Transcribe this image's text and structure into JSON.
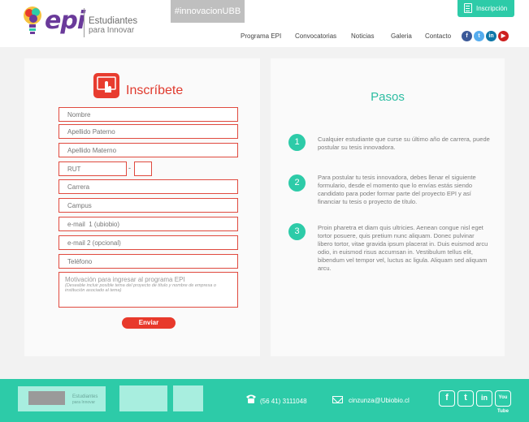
{
  "header": {
    "logo_text": "epi",
    "tagline_line1": "Estudiantes",
    "tagline_line2": "para Innovar",
    "hashtag": "#innovacionUBB",
    "inscripcion_button": "Inscripción",
    "nav": [
      "Programa EPI",
      "Convocatorias",
      "Noticias",
      "Galeria",
      "Contacto"
    ],
    "social": [
      {
        "icon": "facebook-icon",
        "glyph": "f",
        "color": "#3b5998"
      },
      {
        "icon": "twitter-icon",
        "glyph": "t",
        "color": "#55acee"
      },
      {
        "icon": "linkedin-icon",
        "glyph": "in",
        "color": "#0e76a8"
      },
      {
        "icon": "youtube-icon",
        "glyph": "▶",
        "color": "#cd201f"
      }
    ]
  },
  "form": {
    "title": "Inscríbete",
    "fields": {
      "nombre": "Nombre",
      "apellido_paterno": "Apellido Paterno",
      "apellido_materno": "Apellido Materno",
      "rut": "RUT",
      "rut_separator": "-",
      "carrera": "Carrera",
      "campus": "Campus",
      "email1": "e-mail  1 (ubiobio)",
      "email2": "e-mail 2 (opcional)",
      "telefono": "Teléfono",
      "motivacion": "Motivación para ingresar al programa EPI",
      "motivacion_hint": "(Deseable incluir posible tema del proyecto de título y nombre de empresa o institución asociado al tema)"
    },
    "submit": "Enviar",
    "accent_color": "#e8392b"
  },
  "steps": {
    "title": "Pasos",
    "items": [
      {
        "num": "1",
        "text": "Cualquier estudiante que curse su último año de carrera, puede postular su tesis innovadora."
      },
      {
        "num": "2",
        "text": "Para postular tu tesis innovadora, debes llenar el siguiente formulario, desde el momento que lo envías estás siendo candidato para poder formar parte del proyecto EPI y así financiar tu tesis o proyecto de título."
      },
      {
        "num": "3",
        "text": "Proin pharetra et diam quis ultricies. Aenean congue nisl eget tortor posuere, quis pretium nunc aliquam. Donec pulvinar libero tortor, vitae gravida ipsum placerat in. Duis euismod arcu odio, in euismod risus accumsan in. Vestibulum tellus elit, bibendum vel tempor vel, luctus ac ligula. Aliquam sed aliquam arcu."
      }
    ],
    "accent_color": "#2dcba8"
  },
  "footer": {
    "logo_text1": "Estudiantes",
    "logo_text2": "para Innovar",
    "phone": "(56 41) 3111048",
    "email": "cinzunza@Ubiobio.cl",
    "social": [
      {
        "icon": "facebook-icon",
        "glyph": "f"
      },
      {
        "icon": "twitter-icon",
        "glyph": "t"
      },
      {
        "icon": "linkedin-icon",
        "glyph": "in"
      },
      {
        "icon": "youtube-icon",
        "glyph": "You Tube"
      }
    ],
    "background": "#2dcba8"
  }
}
